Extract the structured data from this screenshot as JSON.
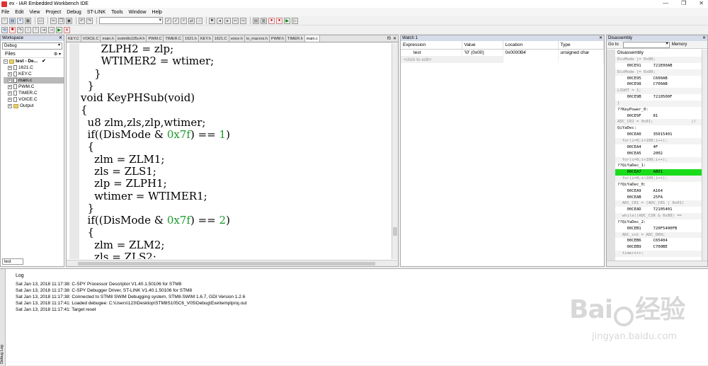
{
  "window": {
    "title": "ex - IAR Embedded Workbench IDE",
    "controls": [
      "—",
      "❐",
      "✕"
    ]
  },
  "menu": [
    "File",
    "Edit",
    "View",
    "Project",
    "Debug",
    "ST-LINK",
    "Tools",
    "Window",
    "Help"
  ],
  "workspace": {
    "pane_title": "Workspace",
    "config": "Debug",
    "files_header": "Files",
    "tree": [
      {
        "label": "test - De...",
        "check": "✔",
        "type": "project"
      },
      {
        "label": "1621.C",
        "type": "file"
      },
      {
        "label": "KEY.C",
        "type": "file"
      },
      {
        "label": "main.c",
        "type": "file"
      },
      {
        "label": "PWM.C",
        "type": "file"
      },
      {
        "label": "TIMER.C",
        "type": "file"
      },
      {
        "label": "VOICE.C",
        "type": "file"
      },
      {
        "label": "Output",
        "type": "folder"
      }
    ],
    "tab": "test"
  },
  "editor": {
    "tabs": [
      "KEY.C",
      "VOICE.C",
      "main.h",
      "iostm8s105c4.h",
      "PWM.C",
      "TIMER.C",
      "1621.h",
      "KEY.h",
      "1621.C",
      "voice.h",
      "io_macros.h",
      "PWM.h",
      "TIMER.h",
      "main.c"
    ],
    "active_tab": "main.c",
    "tab_menu": "f0",
    "tab_close": "✕",
    "code": [
      "      ZLPH2 = zlp;",
      "      WTIMER2 = wtimer;",
      "    }",
      "  }",
      "void KeyPHSub(void)",
      "{",
      "  u8 zlm,zls,zlp,wtimer;",
      "  if((DisMode & 0x7f) == 1)",
      "  {",
      "    zlm = ZLM1;",
      "    zls = ZLS1;",
      "    zlp = ZLPH1;",
      "    wtimer = WTIMER1;",
      "  }",
      "  if((DisMode & 0x7f) == 2)",
      "  {",
      "    zlm = ZLM2;",
      "    zls = ZLS2;"
    ]
  },
  "watch": {
    "pane_title": "Watch 1",
    "columns": [
      "Expression",
      "Value",
      "Location",
      "Type"
    ],
    "rows": [
      {
        "expression": "test",
        "value": "'\\0' (0x00)",
        "location": "0x0000B4",
        "type": "unsigned char"
      }
    ],
    "click_to_add": "<click to edit>"
  },
  "disassembly": {
    "pane_title": "Disassembly",
    "goto_label": "Go to",
    "memory_label": "Memory",
    "title": "Disassembly",
    "lines": [
      {
        "text": "DisMode |= 0x80;",
        "kind": "src"
      },
      {
        "text": "    00CE91     721E00AB",
        "kind": "asm"
      },
      {
        "text": "DisMode |= 0x80;",
        "kind": "src"
      },
      {
        "text": "    00CE95     C600AB",
        "kind": "asm"
      },
      {
        "text": "    00CE98     C700AB",
        "kind": "asm"
      },
      {
        "text": "LIGHT = 1;",
        "kind": "src"
      },
      {
        "text": "    00CE9B     7210500F",
        "kind": "asm"
      },
      {
        "text": "}",
        "kind": "src"
      },
      {
        "text": "??KeyPower_0:",
        "kind": "asm"
      },
      {
        "text": "    00CE9F     81",
        "kind": "asm"
      },
      {
        "text": "ADC_CR1 = 0x01;                //",
        "kind": "src"
      },
      {
        "text": "QiYaDec:",
        "kind": "asm"
      },
      {
        "text": "    00CEA0     35015401",
        "kind": "asm"
      },
      {
        "text": "  for(i=0;i<100;i++);",
        "kind": "src"
      },
      {
        "text": "    00CEA4     4F",
        "kind": "asm"
      },
      {
        "text": "    00CEA5     2002",
        "kind": "asm"
      },
      {
        "text": "  for(i=0;i<100;i++);",
        "kind": "src"
      },
      {
        "text": "??QiYaDec_1:",
        "kind": "asm"
      },
      {
        "text": "    00CEA7     AB01",
        "kind": "hl"
      },
      {
        "text": "  for(i=0;i<100;i++);",
        "kind": "src"
      },
      {
        "text": "??QiYaDec_0:",
        "kind": "asm"
      },
      {
        "text": "    00CEA9     A164",
        "kind": "asm"
      },
      {
        "text": "    00CEAB     25FA",
        "kind": "asm"
      },
      {
        "text": "  ADC_CR1 = (ADC_CR1 | 0x01)",
        "kind": "src"
      },
      {
        "text": "    00CEAD     72105401",
        "kind": "asm"
      },
      {
        "text": "  while((ADC_CSR & 0x80) ==",
        "kind": "src"
      },
      {
        "text": "??QiYaDec_2:",
        "kind": "asm"
      },
      {
        "text": "    00CEB1     720F5400FB",
        "kind": "asm"
      },
      {
        "text": "  ADC_cnt = ADC_DRH;",
        "kind": "src"
      },
      {
        "text": "    00CEB6     C65404",
        "kind": "asm"
      },
      {
        "text": "    00CEB9     C700BE",
        "kind": "asm"
      },
      {
        "text": "  timers++;",
        "kind": "src"
      }
    ]
  },
  "log": {
    "side_label": "Debug Log",
    "header": "Log",
    "lines": [
      "Sat Jan 13, 2018 11:17:38: C-SPY Processor Descriptor V1.40.1.50106 for STM8",
      "Sat Jan 13, 2018 11:17:38: C-SPY Debugger Driver, ST-LINK V1.40.1.50106 for STM8",
      "Sat Jan 13, 2018 11:17:38: Connected to STM8 SWIM Debugging system, STM8-SWIM 1.6.7, GDI Version 1.2.6",
      "Sat Jan 13, 2018 11:17:41: Loaded debugee: C:\\Users\\123\\Desktop\\STM8S105C6_V05\\Debug\\Exe\\templproj.out",
      "Sat Jan 13, 2018 11:17:41: Target reset"
    ]
  },
  "watermark": {
    "brand_left": "Bai",
    "brand_right": "经验",
    "url": "jingyan.baidu.com"
  }
}
